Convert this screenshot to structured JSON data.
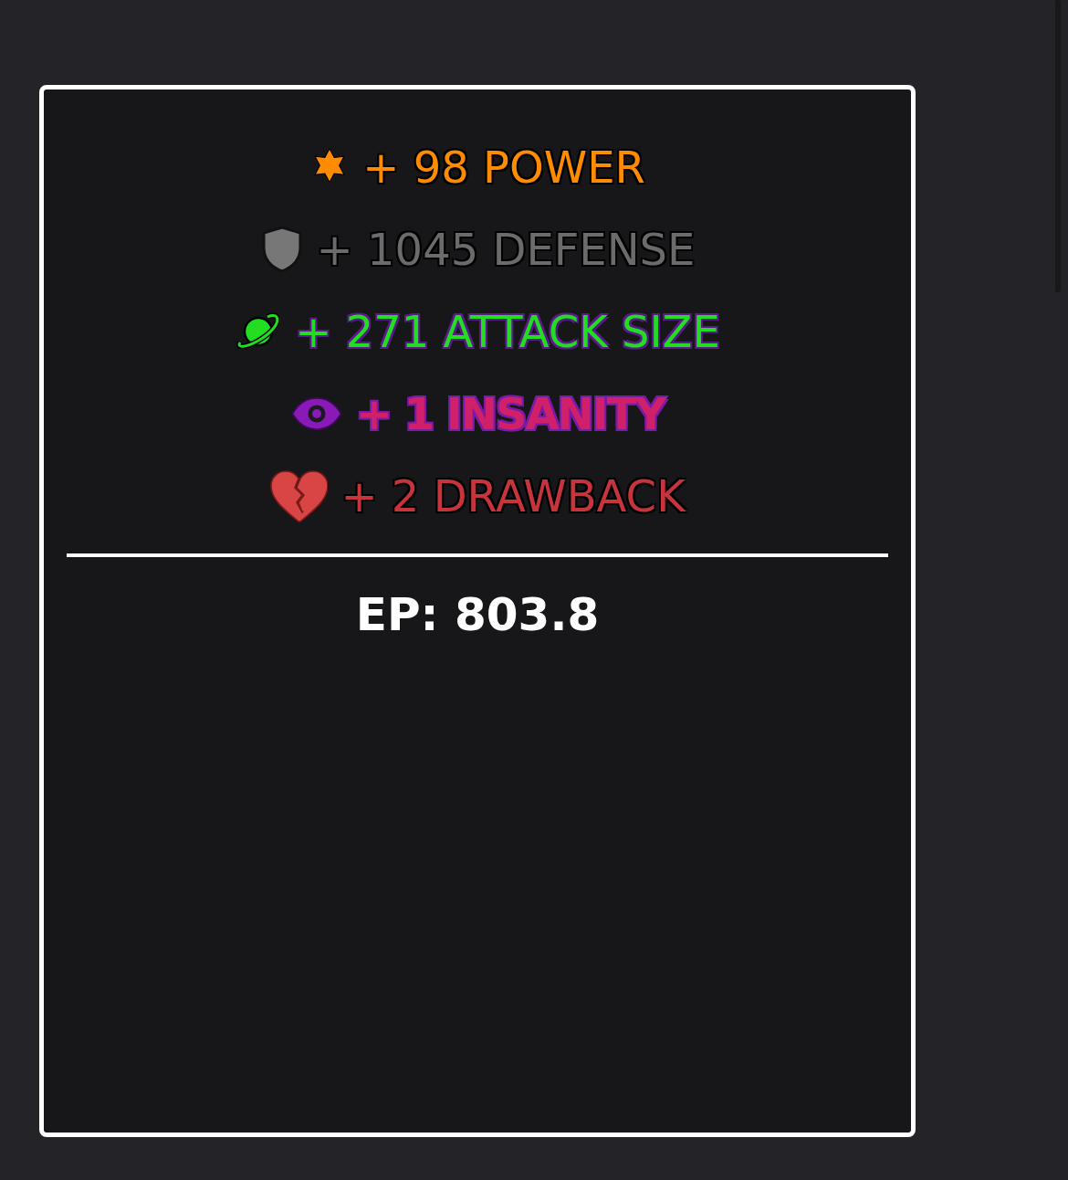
{
  "stats": [
    {
      "kind": "power",
      "text": "+ 98 POWER",
      "color": "#ff8c00",
      "bold": false
    },
    {
      "kind": "defense",
      "text": "+ 1045 DEFENSE",
      "color": "#6b6b6b",
      "bold": false
    },
    {
      "kind": "attack_size",
      "text": "+ 271 ATTACK SIZE",
      "color": "#22dd22",
      "bold": false
    },
    {
      "kind": "insanity",
      "text": "+ 1 INSANITY",
      "color": "#d0206a",
      "bold": true
    },
    {
      "kind": "drawback",
      "text": "+ 2 DRAWBACK",
      "color": "#c8343c",
      "bold": false
    }
  ],
  "ep": "EP: 803.8"
}
